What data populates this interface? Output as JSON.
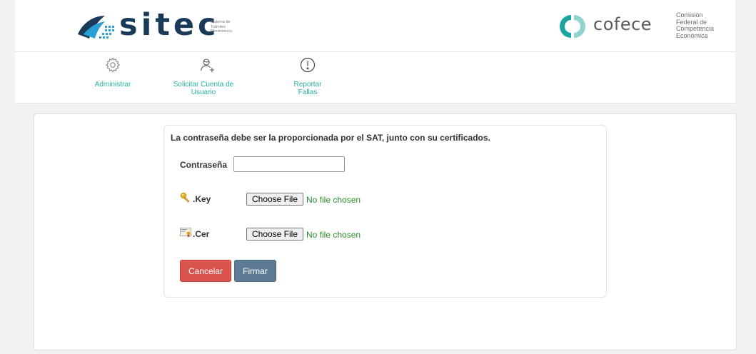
{
  "header": {
    "sitec": {
      "wordmark": "sitec",
      "subtitle_lines": [
        "Sistema de",
        "Trámites",
        "Electrónicos"
      ]
    },
    "cofece": {
      "wordmark": "cofece",
      "subtitle_lines": [
        "Comisión",
        "Federal de",
        "Competencia",
        "Económica"
      ]
    }
  },
  "nav": {
    "items": [
      {
        "label": "Administrar",
        "icon": "gear-icon"
      },
      {
        "label": "Solicitar Cuenta de Usuario",
        "icon": "add-user-icon"
      },
      {
        "label": "Reportar Fallas",
        "icon": "alert-icon"
      }
    ]
  },
  "form": {
    "title": "La contraseña debe ser la proporcionada por el SAT, junto con su certificados.",
    "password_label": "Contraseña",
    "password_value": "",
    "key_label": ".Key",
    "cer_label": ".Cer",
    "choose_file_label": "Choose File",
    "no_file_label": "No file chosen",
    "cancel_label": "Cancelar",
    "sign_label": "Firmar"
  },
  "colors": {
    "nav_text": "#24b3a1",
    "cancel_button": "#d9534f",
    "sign_button": "#5e7b95",
    "file_status": "#2a8f2a",
    "sitec_navy": "#1a3a5a",
    "sitec_teal": "#2a9fd6",
    "cofece_teal": "#1aa5a0"
  }
}
